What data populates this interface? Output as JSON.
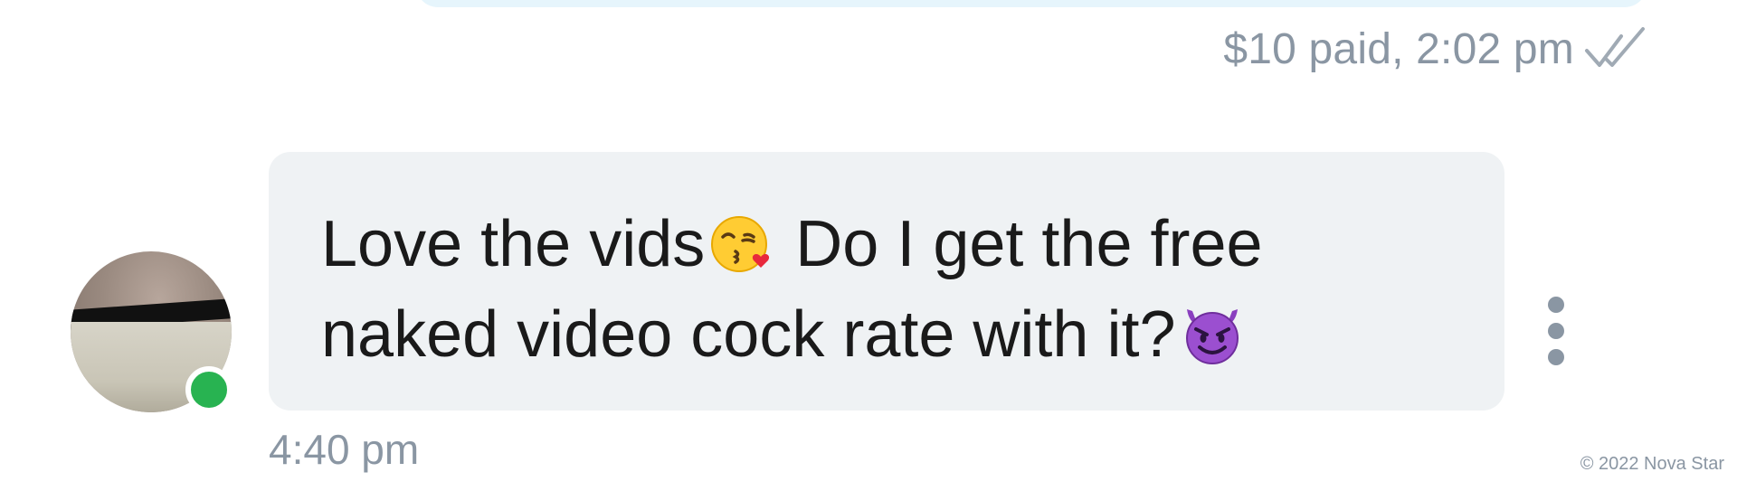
{
  "sent_message": {
    "meta": "$10 paid, 2:02 pm",
    "status_icon": "double-check-read-icon"
  },
  "received_message": {
    "text_part1": "Love the vids",
    "emoji1": "kissing-heart-emoji",
    "text_part2": " Do I get the free",
    "text_part3": "naked video cock rate with it?",
    "emoji2": "smiling-devil-emoji",
    "time": "4:40 pm"
  },
  "sender": {
    "online": true
  },
  "menu_icon": "more-vertical-icon",
  "watermark": "© 2022 Nova Star",
  "colors": {
    "incoming_bubble": "#eff2f4",
    "outgoing_bubble": "#e6f5fc",
    "meta_text": "#8a96a3",
    "online": "#28b351"
  }
}
